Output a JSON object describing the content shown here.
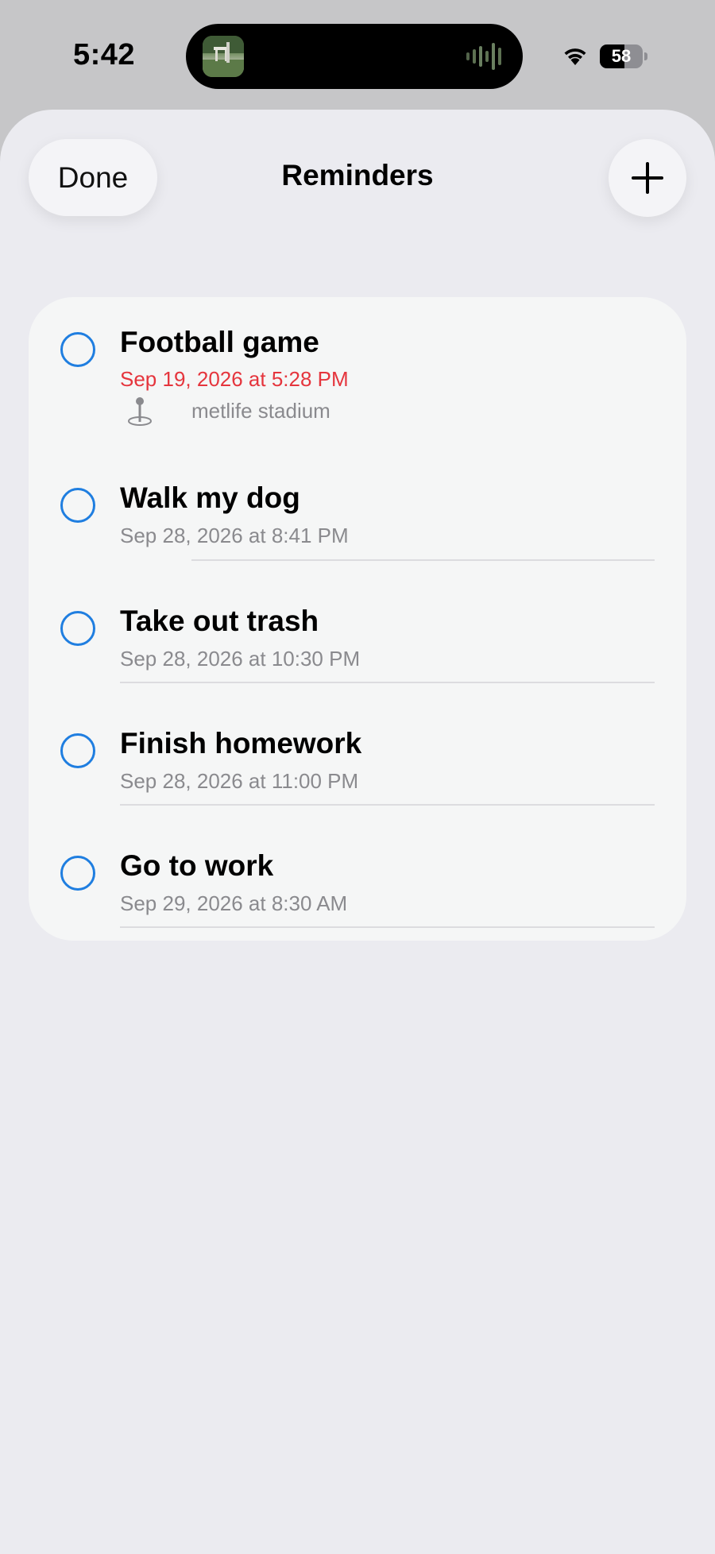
{
  "status_bar": {
    "time": "5:42",
    "battery_level": "58",
    "battery_fraction": 0.58
  },
  "header": {
    "done_label": "Done",
    "title": "Reminders",
    "add_icon": "plus-icon"
  },
  "reminders": [
    {
      "title": "Football game",
      "date": "Sep 19, 2026 at 5:28 PM",
      "overdue": true,
      "location": "metlife stadium"
    },
    {
      "title": "Walk my dog",
      "date": "Sep 28, 2026 at 8:41 PM",
      "overdue": false
    },
    {
      "title": "Take out trash",
      "date": "Sep 28, 2026 at 10:30 PM",
      "overdue": false
    },
    {
      "title": "Finish homework",
      "date": "Sep 28, 2026 at 11:00 PM",
      "overdue": false
    },
    {
      "title": "Go to work",
      "date": "Sep 29, 2026 at 8:30 AM",
      "overdue": false
    }
  ],
  "colors": {
    "checkbox": "#1f7ee0",
    "overdue": "#e5353d",
    "secondary_text": "#8a8a8e"
  }
}
